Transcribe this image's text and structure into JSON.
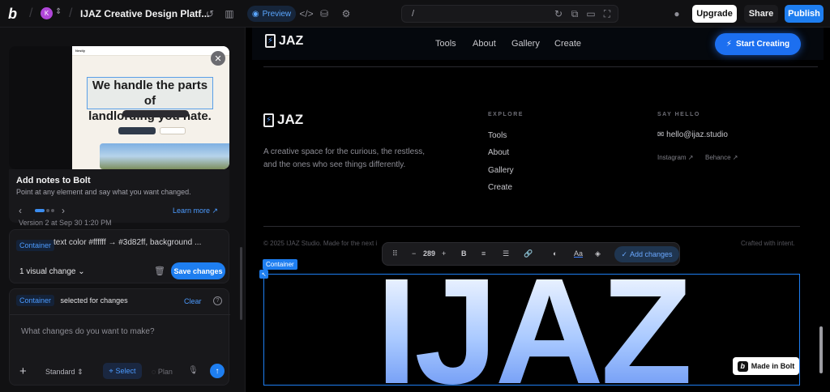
{
  "topbar": {
    "project_title": "IJAZ Creative Design Platf...",
    "avatar_initial": "K",
    "preview_label": "Preview",
    "url_path": "/",
    "upgrade_label": "Upgrade",
    "share_label": "Share",
    "publish_label": "Publish"
  },
  "thumbnail": {
    "headline_line1": "We handle the parts of",
    "headline_line2": "landlording you hate.",
    "nav_brand": "Nestly"
  },
  "tip": {
    "title": "Add notes to Bolt",
    "subtitle": "Point at any element and say what you want changed.",
    "learn_more": "Learn more ↗"
  },
  "version_line": "Version 2 at Sep 30 1:20 PM",
  "change_card": {
    "tag": "Container",
    "description": "text color #ffffff → #3d82ff, background ...",
    "count": "1 visual change",
    "save_label": "Save changes"
  },
  "chat": {
    "tag": "Container",
    "selected_text": "selected for changes",
    "clear_label": "Clear",
    "placeholder": "What changes do you want to make?",
    "mode": "Standard",
    "select_label": "Select",
    "plan_label": "Plan"
  },
  "site": {
    "brand": "JAZ",
    "nav_links": [
      "Tools",
      "About",
      "Gallery",
      "Create"
    ],
    "cta": "Start Creating",
    "tagline": "A creative space for the curious, the restless, and the ones who see things differently.",
    "explore_heading": "EXPLORE",
    "explore_links": [
      "Tools",
      "About",
      "Gallery",
      "Create"
    ],
    "hello_heading": "SAY HELLO",
    "email": "hello@ijaz.studio",
    "social_instagram": "Instagram ↗",
    "social_behance": "Behance ↗",
    "copyright": "© 2025 IJAZ Studio. Made for the next i",
    "crafted": "Crafted with intent.",
    "big_text": "IJAZ",
    "made_in_bolt": "Made in Bolt"
  },
  "format_toolbar": {
    "size_value": "289",
    "add_changes_label": "Add changes"
  },
  "selection": {
    "label": "Container"
  },
  "colors": {
    "accent": "#1e7ef0",
    "bg": "#0a0a0b",
    "big_text_gradient_top": "#ffffff",
    "big_text_gradient_bottom": "#5e8cf2"
  }
}
